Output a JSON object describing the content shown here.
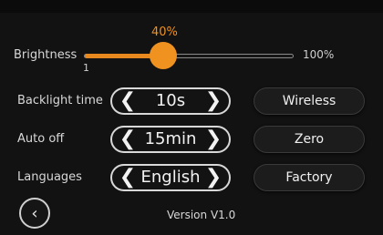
{
  "brightness": {
    "label": "Brightness",
    "value_text": "40%",
    "value": 0.4,
    "min_text": "1",
    "max_text": "100%"
  },
  "settings": [
    {
      "label": "Backlight time",
      "value": "10s",
      "left_icon": "chevron-left-icon",
      "right_icon": "chevron-right-icon"
    },
    {
      "label": "Auto off",
      "value": "15min",
      "left_icon": "chevron-left-icon",
      "right_icon": "chevron-right-icon"
    },
    {
      "label": "Languages",
      "value": "English",
      "left_icon": "chevron-left-icon",
      "right_icon": "chevron-right-icon"
    }
  ],
  "buttons": {
    "wireless": "Wireless",
    "zero": "Zero",
    "factory": "Factory"
  },
  "back_icon": "back-chevron-icon",
  "version": "Version V1.0",
  "colors": {
    "accent": "#f0921f",
    "background": "#121212"
  }
}
